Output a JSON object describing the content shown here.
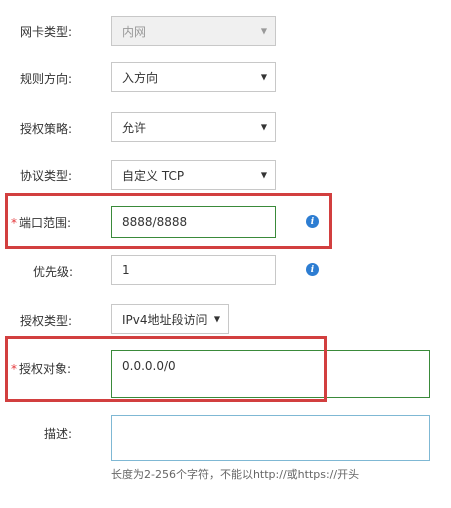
{
  "form": {
    "nic_type": {
      "label": "网卡类型:",
      "value": "内网",
      "disabled": true
    },
    "direction": {
      "label": "规则方向:",
      "value": "入方向"
    },
    "policy": {
      "label": "授权策略:",
      "value": "允许"
    },
    "protocol": {
      "label": "协议类型:",
      "value": "自定义 TCP"
    },
    "port_range": {
      "required_mark": "*",
      "label": "端口范围:",
      "value": "8888/8888"
    },
    "priority": {
      "label": "优先级:",
      "value": "1"
    },
    "auth_type": {
      "label": "授权类型:",
      "value": "IPv4地址段访问"
    },
    "auth_object": {
      "required_mark": "*",
      "label": "授权对象:",
      "value": "0.0.0.0/0"
    },
    "description": {
      "label": "描述:",
      "value": "",
      "hint": "长度为2-256个字符，不能以http://或https://开头"
    }
  },
  "icons": {
    "info": "i",
    "dropdown": "▼"
  },
  "colors": {
    "highlight_border": "#d23f3f",
    "valid_border": "#3a8a3a",
    "info_icon": "#2d7dd2",
    "required_mark": "#e4393c"
  }
}
